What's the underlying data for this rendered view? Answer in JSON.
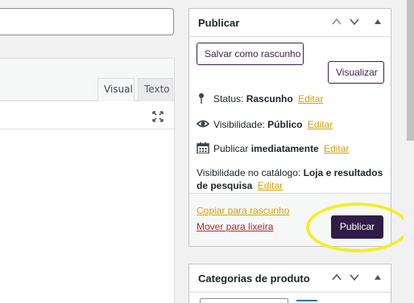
{
  "editor": {
    "tabs": [
      {
        "label": "Visual",
        "active": true
      },
      {
        "label": "Texto",
        "active": false
      }
    ]
  },
  "publish": {
    "title": "Publicar",
    "save_draft_label": "Salvar como rascunho",
    "preview_label": "Visualizar",
    "status_label": "Status:",
    "status_value": "Rascunho",
    "visibility_label": "Visibilidade:",
    "visibility_value": "Público",
    "publish_label": "Publicar",
    "publish_value": "imediatamente",
    "catalog_label": "Visibilidade no catálogo:",
    "catalog_value": "Loja e resultados de pesquisa",
    "edit_label": "Editar",
    "copy_draft_label": "Copiar para rascunho",
    "trash_label": "Mover para lixeira",
    "publish_button_label": "Publicar"
  },
  "categories": {
    "title": "Categorias de produto"
  },
  "colors": {
    "primary": "#2f1c47",
    "link": "#d4a20a",
    "trash": "#b32d2e",
    "highlight": "#f4ee27"
  }
}
